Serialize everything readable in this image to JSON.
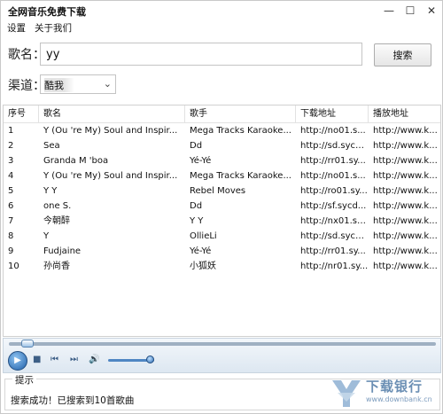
{
  "window": {
    "title": "全网音乐免费下载",
    "min_glyph": "—",
    "max_glyph": "☐",
    "close_glyph": "✕"
  },
  "menu": {
    "items": [
      "设置",
      "关于我们"
    ]
  },
  "search": {
    "song_label": "歌名：",
    "song_value": "yy",
    "search_button": "搜索",
    "channel_label": "渠道：",
    "channel_value": "酷我",
    "channel_arrow": "⌄"
  },
  "table": {
    "headers": [
      "序号",
      "歌名",
      "歌手",
      "下载地址",
      "播放地址"
    ],
    "rows": [
      [
        "1",
        "Y (Ou   're My) Soul and Inspir...",
        "Mega Tracks Karaoke...",
        "http://no01.s...",
        "http://www.k..."
      ],
      [
        "2",
        "Sea",
        "Dd",
        "http://sd.sycd...",
        "http://www.k..."
      ],
      [
        "3",
        "Granda M   'boa",
        "Yé-Yé",
        "http://rr01.sy...",
        "http://www.k..."
      ],
      [
        "4",
        "Y (Ou   're My) Soul and Inspir...",
        "Mega Tracks Karaoke...",
        "http://no01.s...",
        "http://www.k..."
      ],
      [
        "5",
        "Y Y",
        "Rebel Moves",
        "http://ro01.sy...",
        "http://www.k..."
      ],
      [
        "6",
        "one S.",
        "Dd",
        "http://sf.sycd...",
        "http://www.k..."
      ],
      [
        "7",
        "今朝醉",
        " Y Y",
        "http://nx01.sy...",
        "http://www.k..."
      ],
      [
        "8",
        "Y",
        "OllieLi",
        "http://sd.sycd...",
        "http://www.k..."
      ],
      [
        "9",
        "Fudjaine",
        "Yé-Yé",
        "http://rr01.sy...",
        "http://www.k..."
      ],
      [
        "10",
        "孙尚香",
        "小狐妖",
        "http://nr01.sy...",
        "http://www.k..."
      ]
    ]
  },
  "player": {
    "play_glyph": "▶",
    "stop_glyph": "■",
    "prev_glyph": "⏮",
    "next_glyph": "⏭",
    "volume_glyph": "🔊",
    "seek_progress": 0.03,
    "volume_level": 0.9
  },
  "status": {
    "title": "提示",
    "text": "搜索成功！已搜索到10首歌曲"
  },
  "watermark": {
    "name": "下载银行",
    "url": "www.downbank.cn"
  }
}
